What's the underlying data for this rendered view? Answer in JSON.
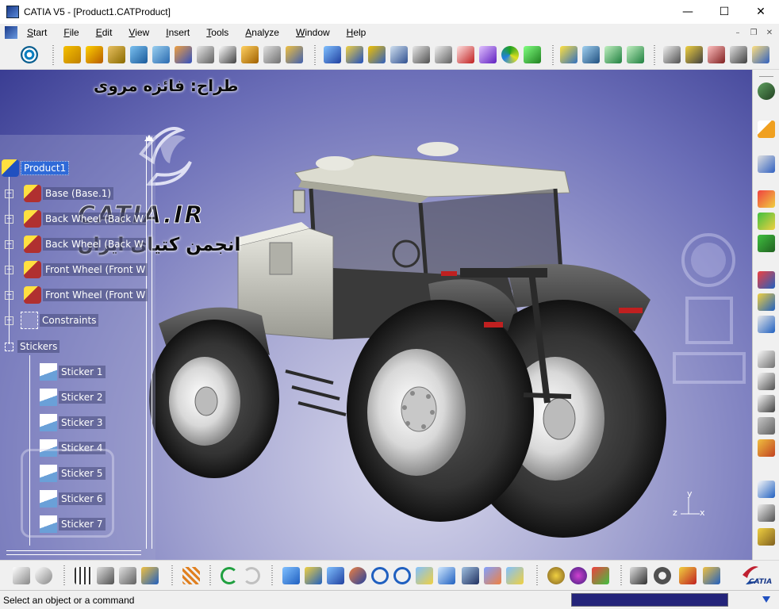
{
  "window": {
    "title": "CATIA V5 - [Product1.CATProduct]",
    "minimize": "—",
    "maximize": "☐",
    "close": "✕"
  },
  "menu": {
    "items": [
      "Start",
      "File",
      "Edit",
      "View",
      "Insert",
      "Tools",
      "Analyze",
      "Window",
      "Help"
    ],
    "mdi_minimize": "–",
    "mdi_restore": "❐",
    "mdi_close": "✕"
  },
  "tree": {
    "root": "Product1",
    "nodes": [
      "Base (Base.1)",
      "Back Wheel (Back W",
      "Back Wheel (Back W",
      "Front Wheel (Front W",
      "Front Wheel (Front W",
      "Constraints"
    ],
    "stickers_label": "Stickers",
    "stickers": [
      "Sticker 1",
      "Sticker 2",
      "Sticker 3",
      "Sticker 4",
      "Sticker 5",
      "Sticker 6",
      "Sticker 7"
    ]
  },
  "watermarks": {
    "designer": "طراح: فائزه مروی",
    "site": "CATIA.IR",
    "society": "انجمن کتیای ایران"
  },
  "compass": {
    "y": "y",
    "z": "z",
    "x": "x"
  },
  "brand": {
    "catia_small": "CATIA"
  },
  "status": {
    "message": "Select an object or a command"
  },
  "colors": {
    "viewport_center": "#d8d8ec",
    "viewport_edge": "#3a3d93",
    "selection": "#2f6ad8",
    "status_input": "#24247a"
  }
}
